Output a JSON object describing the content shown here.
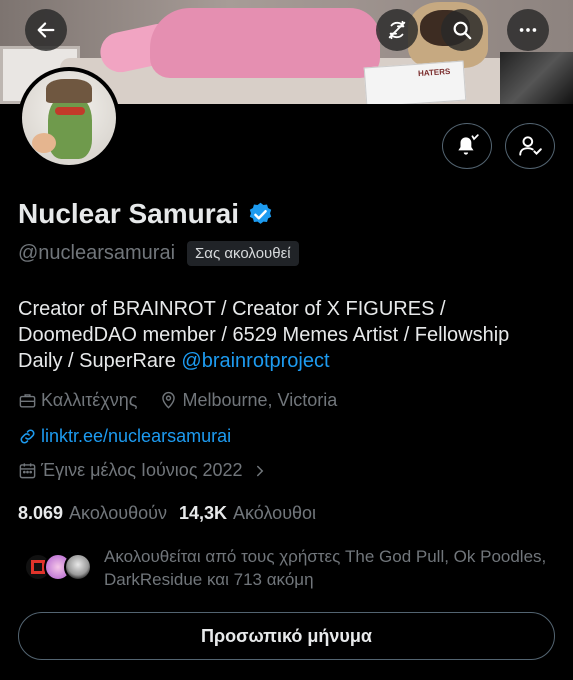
{
  "header": {
    "back_icon": "arrow-left-icon",
    "refresh_icon": "refresh-icon",
    "search_icon": "search-icon",
    "more_icon": "more-horizontal-icon",
    "banner_text": "HATERS"
  },
  "profile": {
    "display_name": "Nuclear Samurai",
    "verified": true,
    "handle": "@nuclearsamurai",
    "follows_you_badge": "Σας ακολουθεί",
    "bio_text": "Creator of BRAINROT / Creator of X FIGURES / DoomedDAO member / 6529 Memes Artist / Fellowship Daily / SuperRare ",
    "bio_mention": "@brainrotproject",
    "profession": "Καλλιτέχνης",
    "location": "Melbourne, Victoria",
    "link": "linktr.ee/nuclearsamurai",
    "joined": "Έγινε μέλος Ιούνιος 2022",
    "following_count": "8.069",
    "following_label": "Ακολουθούν",
    "followers_count": "14,3K",
    "followers_label": "Ακόλουθοι",
    "followed_by_text": "Ακολουθείται από τους χρήστες The God Pull, Ok Poodles, DarkResidue και 713 ακόμη"
  },
  "actions": {
    "notify_icon": "bell-plus-icon",
    "following_icon": "person-check-icon",
    "dm_button_label": "Προσωπικό μήνυμα"
  },
  "colors": {
    "accent": "#1d9bf0",
    "background": "#000000",
    "text_secondary": "#71767b",
    "border": "#536471"
  }
}
